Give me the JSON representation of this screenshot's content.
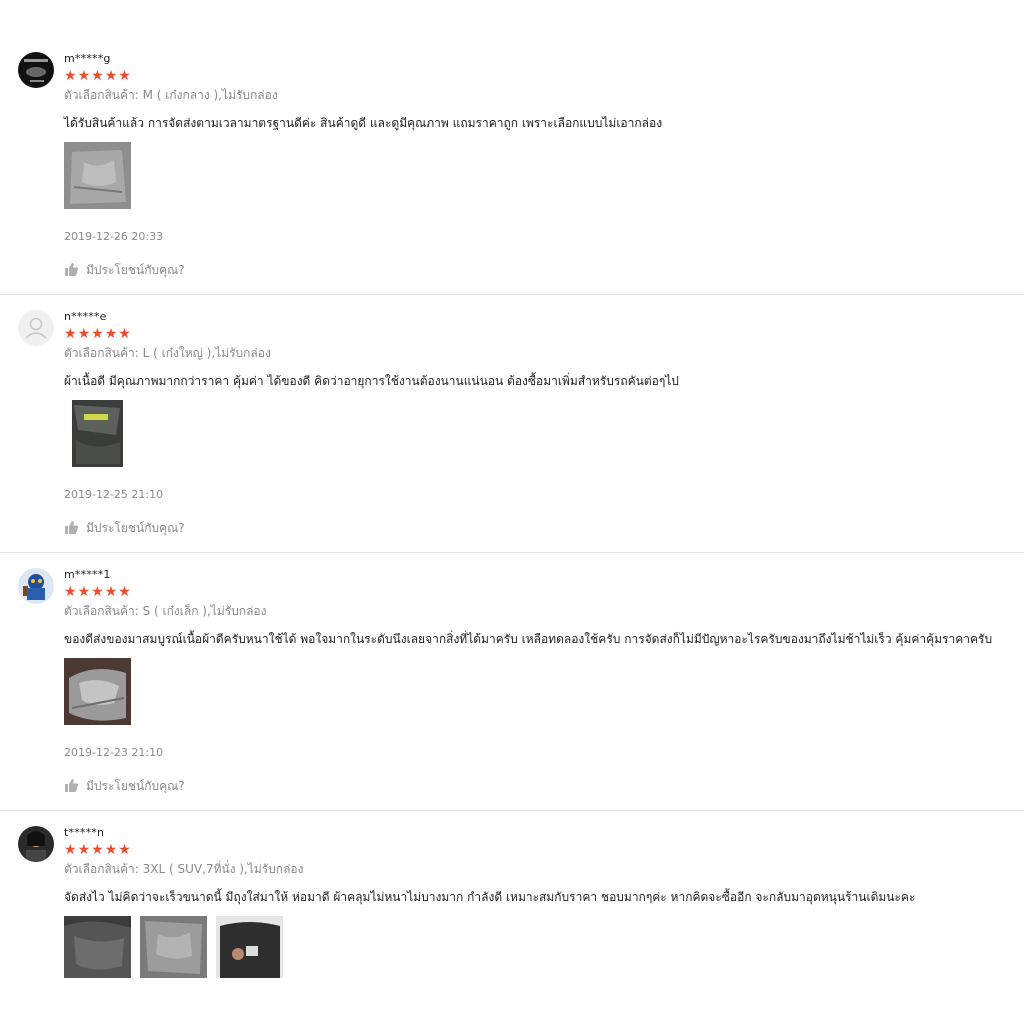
{
  "colors": {
    "star": "#ee4d2d",
    "muted": "#8a8a8a",
    "divider": "#e5e5e5"
  },
  "icons": {
    "star": "★",
    "like": "thumbs-up-icon"
  },
  "reviews": [
    {
      "username": "m*****g",
      "rating": 5,
      "variation": "ตัวเลือกสินค้า: M ( เก๋งกลาง ),ไม่รับกล่อง",
      "comment": "ได้รับสินค้าแล้ว  การจัดส่งตามเวลามาตรฐานดีค่ะ สินค้าดูดี  และดูมีคุณภาพ แถมราคาถูก เพราะเลือกแบบไม่เอากล่อง",
      "date": "2019-12-26 20:33",
      "helpful_label": "มีประโยชน์กับคุณ?"
    },
    {
      "username": "n*****e",
      "rating": 5,
      "variation": "ตัวเลือกสินค้า: L ( เก๋งใหญ่ ),ไม่รับกล่อง",
      "comment": "ผ้าเนื้อดี มีคุณภาพมากกว่าราคา คุ้มค่า ได้ของดี คิดว่าอายุการใช้งานต้องนานแน่นอน ต้องซื้อมาเพิ่มสำหรับรถคันต่อๆไป",
      "date": "2019-12-25 21:10",
      "helpful_label": "มีประโยชน์กับคุณ?"
    },
    {
      "username": "m*****1",
      "rating": 5,
      "variation": "ตัวเลือกสินค้า: S ( เก๋งเล็ก ),ไม่รับกล่อง",
      "comment": "ของดีส่งของมาสมบูรณ์เนื้อผ้าดีครับหนาใช้ได้ พอใจมากในระดับนึงเลยจากสิ่งที่ได้มาครับ เหลือทดลองใช้ครับ การจัดส่งก็ไม่มีปัญหาอะไรครับของมาถึงไม่ช้าไม่เร็ว คุ้มค่าคุ้มราคาครับ",
      "date": "2019-12-23 21:10",
      "helpful_label": "มีประโยชน์กับคุณ?"
    },
    {
      "username": "t*****n",
      "rating": 5,
      "variation": "ตัวเลือกสินค้า: 3XL ( SUV,7ที่นั่ง ),ไม่รับกล่อง",
      "comment": "จัดส่งไว ไม่คิดว่าจะเร็วขนาดนี้ มีถุงใส่มาให้ ห่อมาดี ผ้าคลุมไม่หนาไม่บางมาก กำลังดี เหมาะสมกับราคา ชอบมากๆค่ะ หากคิดจะซื้ออีก จะกลับมาอุดหนุนร้านเดิมนะคะ"
    }
  ]
}
